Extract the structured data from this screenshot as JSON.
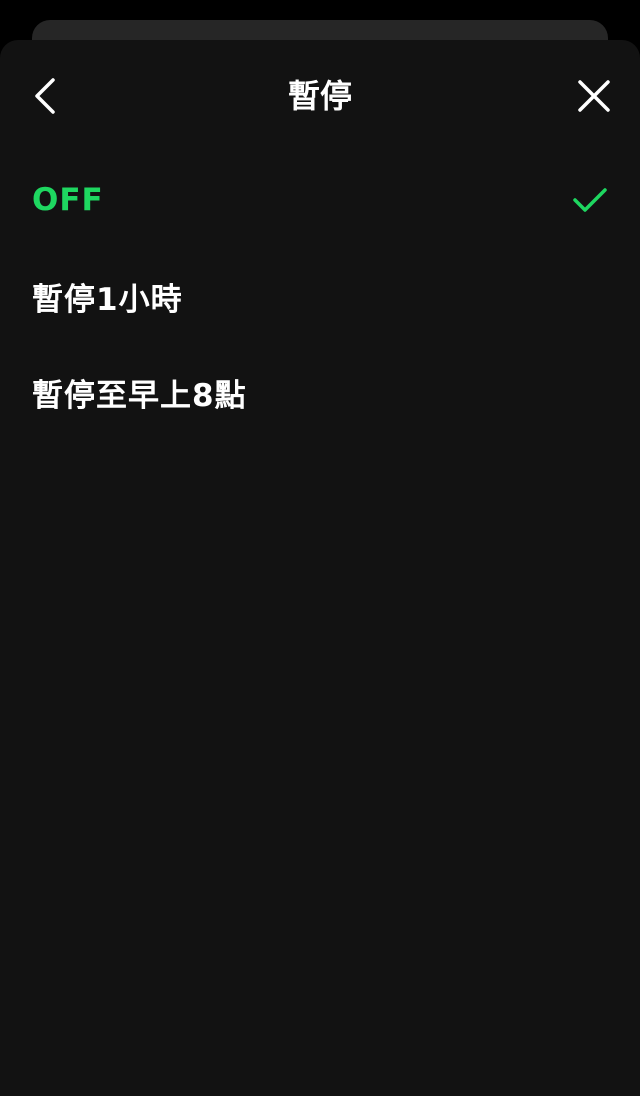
{
  "header": {
    "title": "暫停"
  },
  "options": [
    {
      "label": "OFF",
      "selected": true
    },
    {
      "label": "暫停1小時",
      "selected": false
    },
    {
      "label": "暫停至早上8點",
      "selected": false
    }
  ],
  "colors": {
    "accent": "#1ed760",
    "background": "#121212",
    "text": "#ffffff"
  },
  "icons": {
    "back": "chevron-left-icon",
    "close": "close-icon",
    "selected": "check-icon"
  }
}
